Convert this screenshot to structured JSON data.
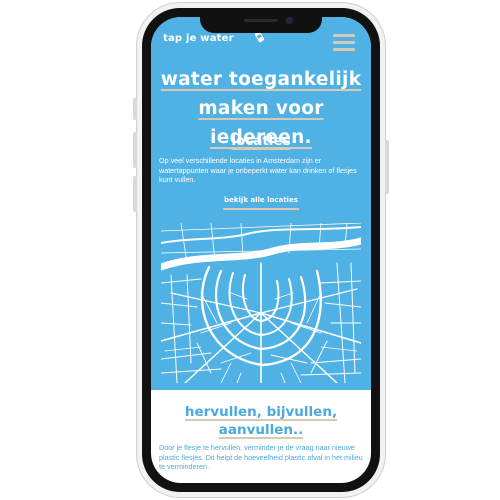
{
  "colors": {
    "brand_blue": "#50b1e4",
    "accent_beige": "#d8c9b5",
    "text_blue": "#4aaadf",
    "white": "#ffffff"
  },
  "nav": {
    "logo_text": "tap je water",
    "logo_icon": "water-bottle-icon",
    "menu_icon": "hamburger-menu-icon"
  },
  "hero": {
    "title_line1": "water toegankelijk",
    "title_line2": "maken voor iedereen."
  },
  "locations": {
    "heading": "locaties",
    "text": "Op veel verschillende locaties in Amsterdam zijn er watertappunten waar je onbeperkt water kan drinken of flesjes kunt vullen.",
    "link_label": "bekijk alle locaties",
    "map_icon": "city-street-map"
  },
  "refill": {
    "heading_line1": "hervullen, bijvullen,",
    "heading_line2": "aanvullen..",
    "text": "Door je flesje te hervullen, verminder je de vraag naar nieuwe plastic flesjes. Dit helpt de hoeveelheid plastic afval in het milieu te verminderen."
  }
}
